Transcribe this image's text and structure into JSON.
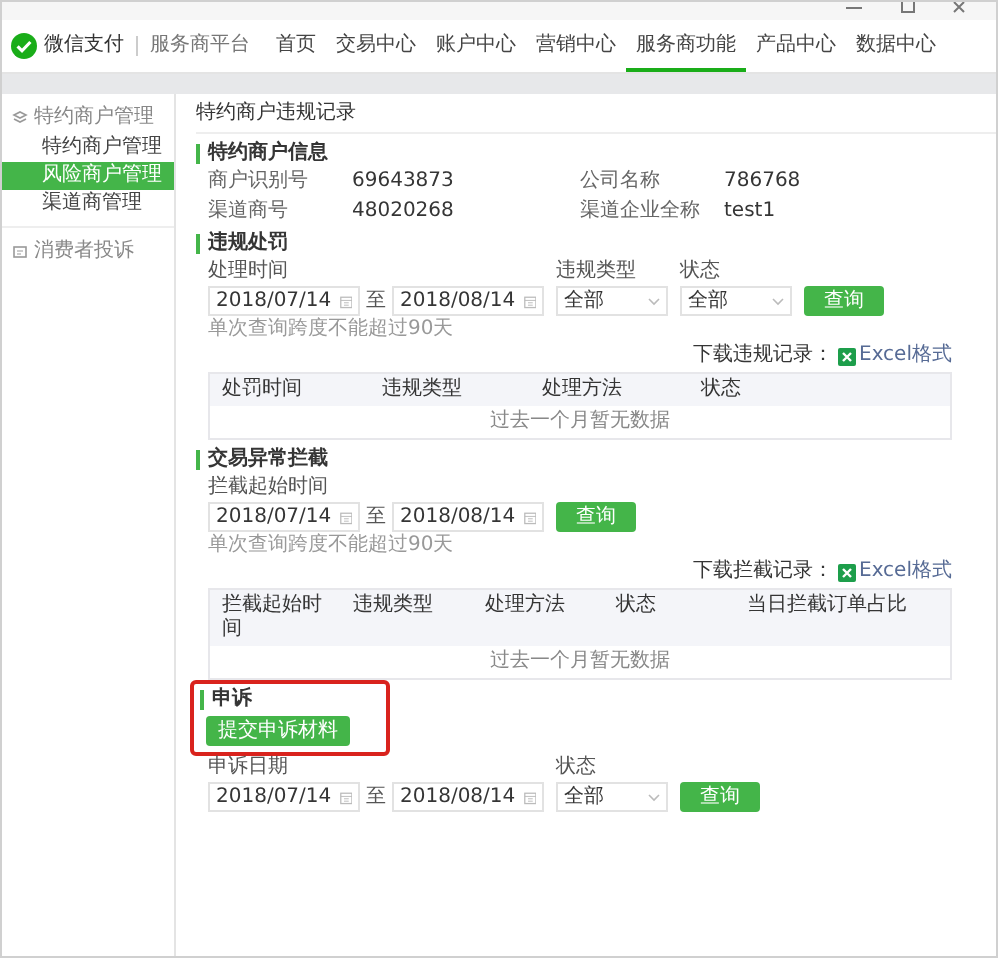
{
  "brand": {
    "name": "微信支付",
    "platform": "服务商平台"
  },
  "nav": [
    {
      "label": "首页",
      "selected": false
    },
    {
      "label": "交易中心",
      "selected": false
    },
    {
      "label": "账户中心",
      "selected": false
    },
    {
      "label": "营销中心",
      "selected": false
    },
    {
      "label": "服务商功能",
      "selected": true
    },
    {
      "label": "产品中心",
      "selected": false
    },
    {
      "label": "数据中心",
      "selected": false
    }
  ],
  "sidebar": [
    {
      "label": "特约商户管理",
      "children": [
        {
          "label": "特约商户管理",
          "selected": false
        },
        {
          "label": "风险商户管理",
          "selected": true
        },
        {
          "label": "渠道商管理",
          "selected": false
        }
      ]
    },
    {
      "label": "消费者投诉"
    }
  ],
  "page_title": "特约商户违规记录",
  "sections": [
    {
      "title": "特约商户信息",
      "fields": [
        {
          "label": "商户识别号",
          "value": "69643873"
        },
        {
          "label": "公司名称",
          "value": "786768"
        },
        {
          "label": "渠道商号",
          "value": "48020268"
        },
        {
          "label": "渠道企业全称",
          "value": "test1"
        }
      ]
    },
    {
      "title": "违规处罚",
      "filters": [
        {
          "kind": "daterange",
          "label": "处理时间",
          "from": "2018/07/14",
          "separator": "至",
          "to": "2018/08/14"
        },
        {
          "kind": "select",
          "label": "违规类型",
          "value": "全部"
        },
        {
          "kind": "select",
          "label": "状态",
          "value": "全部"
        }
      ],
      "button": "查询",
      "hint": "单次查询跨度不能超过90天",
      "download": {
        "label": "下载违规记录：",
        "link": "Excel格式"
      },
      "table": {
        "columns": [
          "处罚时间",
          "违规类型",
          "处理方法",
          "状态"
        ],
        "empty": "过去一个月暂无数据"
      }
    },
    {
      "title": "交易异常拦截",
      "filters": [
        {
          "kind": "daterange",
          "label": "拦截起始时间",
          "from": "2018/07/14",
          "separator": "至",
          "to": "2018/08/14"
        }
      ],
      "button": "查询",
      "hint": "单次查询跨度不能超过90天",
      "download": {
        "label": "下载拦截记录：",
        "link": "Excel格式"
      },
      "table": {
        "columns": [
          "拦截起始时间",
          "违规类型",
          "处理方法",
          "状态",
          "当日拦截订单占比"
        ],
        "empty": "过去一个月暂无数据"
      }
    },
    {
      "title": "申诉",
      "highlighted": true,
      "submit_button": "提交申诉材料",
      "filters": [
        {
          "kind": "daterange",
          "label": "申诉日期",
          "from": "2018/07/14",
          "separator": "至",
          "to": "2018/08/14"
        },
        {
          "kind": "select",
          "label": "状态",
          "value": "全部"
        }
      ],
      "button": "查询"
    }
  ]
}
